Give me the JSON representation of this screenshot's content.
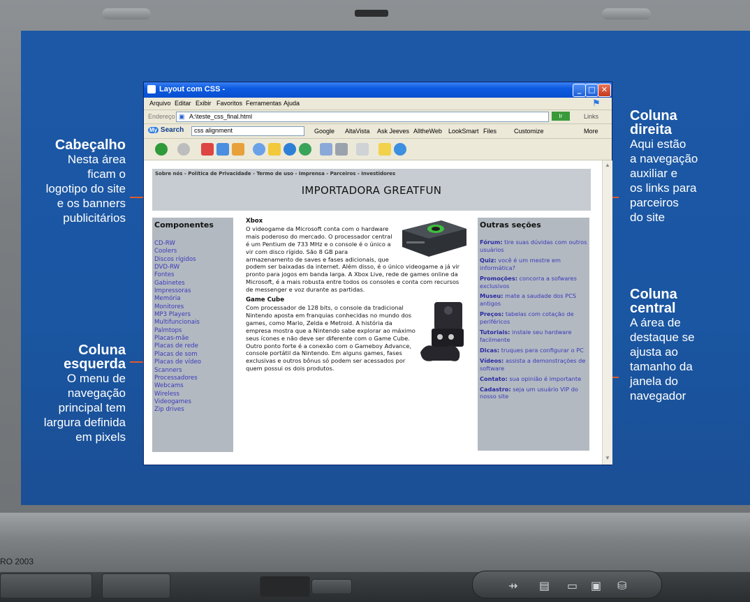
{
  "browser": {
    "title": "Layout com CSS -",
    "menu": [
      "Arquivo",
      "Editar",
      "Exibir",
      "Favoritos",
      "Ferramentas",
      "Ajuda"
    ],
    "address_label": "Endereço",
    "address_value": "A:\\teste_css_final.html",
    "go_label": "Ir",
    "links_label": "Links",
    "search_brand": "Search",
    "search_value": "css alignment",
    "search_engines": [
      "Google",
      "AltaVista",
      "Ask Jeeves",
      "AlltheWeb",
      "LookSmart",
      "Files",
      "Customize",
      "More"
    ]
  },
  "site": {
    "top_links": "Sobre nós - Política de Privacidade - Termo de uso - Imprensa - Parceiros - Investidores",
    "brand": "IMPORTADORA GREATFUN",
    "left_title": "Componentes",
    "left_items": [
      "CD-RW",
      "Coolers",
      "Discos rígidos",
      "DVD-RW",
      "Fontes",
      "Gabinetes",
      "Impressoras",
      "Memória",
      "Monitores",
      "MP3 Players",
      "Multifuncionais",
      "Palmtops",
      "Placas-mãe",
      "Placas de rede",
      "Placas de som",
      "Placas de vídeo",
      "Scanners",
      "Processadores",
      "Webcams",
      "Wireless",
      "Videogames",
      "Zip drives"
    ],
    "center": {
      "xbox_title": "Xbox",
      "xbox_text": "O videogame da Microsoft conta com o hardware mais poderoso do mercado. O processador central é um Pentium de 733 MHz e o console é o único a vir com disco rígido. São 8 GB para armazenamento de saves e fases adicionais, que podem ser baixadas da internet. Além disso, é o único videogame a já vir pronto para jogos em banda larga. A Xbox Live, rede de games online da Microsoft, é a mais robusta entre todos os consoles e conta com recursos de messenger e voz durante as partidas.",
      "gc_title": "Game Cube",
      "gc_text": "Com processador de 128 bits, o console da tradicional Nintendo aposta em franquias conhecidas no mundo dos games, como Mario, Zelda e Metroid. A história da empresa mostra que a Nintendo sabe explorar ao máximo seus ícones e não deve ser diferente com o Game Cube. Outro ponto forte é a conexão com o Gameboy Advance, console portátil da Nintendo. Em alguns games, fases exclusivas e outros bônus só podem ser acessados por quem possui os dois produtos."
    },
    "right_title": "Outras seções",
    "right_items": [
      {
        "label": "Fórum:",
        "text": "tire suas dúvidas com outros usuários"
      },
      {
        "label": "Quiz:",
        "text": "você é um mestre em informática?"
      },
      {
        "label": "Promoções:",
        "text": "concorra a sofwares exclusivos"
      },
      {
        "label": "Museu:",
        "text": "mate a saudade dos PCS antigos"
      },
      {
        "label": "Preços:",
        "text": "tabelas com cotação de periféricos"
      },
      {
        "label": "Tutoriais:",
        "text": "instale seu hardware facilmente"
      },
      {
        "label": "Dicas:",
        "text": "truques para configurar o PC"
      },
      {
        "label": "Vídeos:",
        "text": "assista a demonstrações de software"
      },
      {
        "label": "Contato:",
        "text": "sua opinião é importante"
      },
      {
        "label": "Cadastro:",
        "text": "seja um usuário VIP do nosso site"
      }
    ]
  },
  "annotations": {
    "cabecalho": {
      "title": "Cabeçalho",
      "lines": [
        "Nesta área",
        "ficam o",
        "logotipo do site",
        "e os banners",
        "publicitários"
      ]
    },
    "coluna_esquerda": {
      "title_1": "Coluna",
      "title_2": "esquerda",
      "lines": [
        "O menu de",
        "navegação",
        "principal tem",
        "largura definida",
        "em pixels"
      ]
    },
    "coluna_direita": {
      "title_1": "Coluna",
      "title_2": "direita",
      "lines": [
        "Aqui estão",
        "a navegação",
        "auxiliar e",
        "os links para",
        "parceiros",
        "do site"
      ]
    },
    "coluna_central": {
      "title_1": "Coluna",
      "title_2": "central",
      "lines": [
        "A área de",
        "destaque se",
        "ajusta ao",
        "tamanho da",
        "janela do",
        "navegador"
      ]
    }
  },
  "copyright": "RO 2003",
  "colors": {
    "screen_blue": "#1c58a6",
    "leader_orange": "#e05a2a",
    "column_gray": "#b2b9c1",
    "header_gray": "#c6ccd1"
  }
}
